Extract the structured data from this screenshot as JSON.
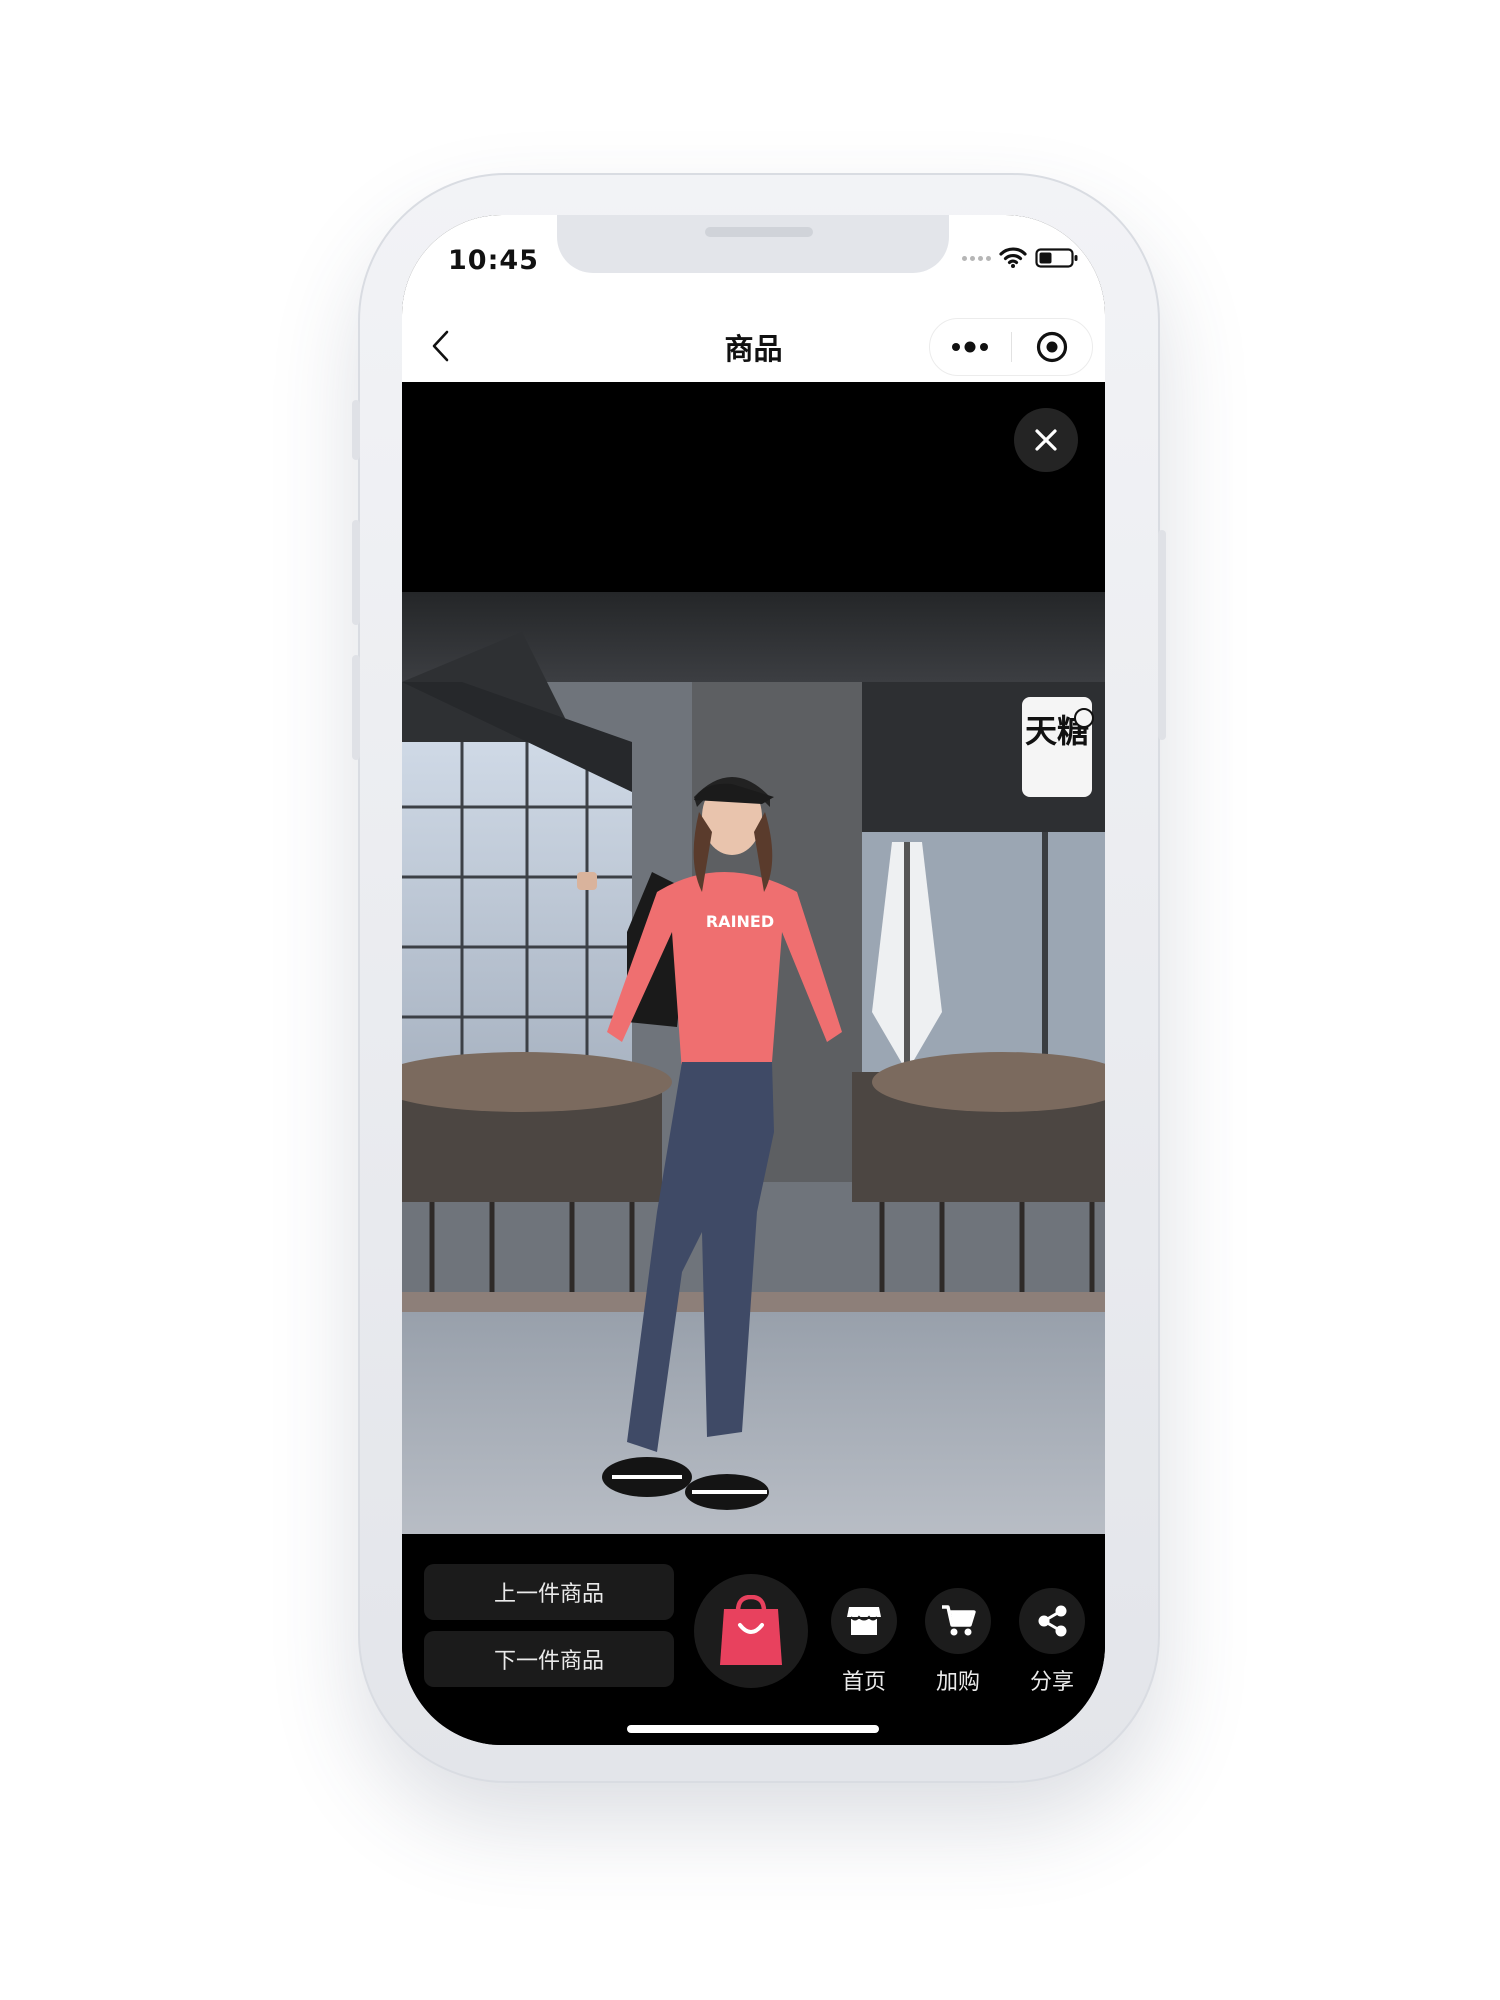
{
  "status_bar": {
    "time": "10:45"
  },
  "navbar": {
    "title": "商品"
  },
  "video": {
    "store_sign": "天糖",
    "shirt_text": "RAINED"
  },
  "bottom_bar": {
    "prev_label": "上一件商品",
    "next_label": "下一件商品",
    "actions": [
      {
        "label": "首页",
        "icon": "store-icon"
      },
      {
        "label": "加购",
        "icon": "cart-icon"
      },
      {
        "label": "分享",
        "icon": "share-icon"
      }
    ]
  },
  "colors": {
    "accent": "#e8415e",
    "shirt": "#ef6f70",
    "jeans": "#3f4a66"
  }
}
